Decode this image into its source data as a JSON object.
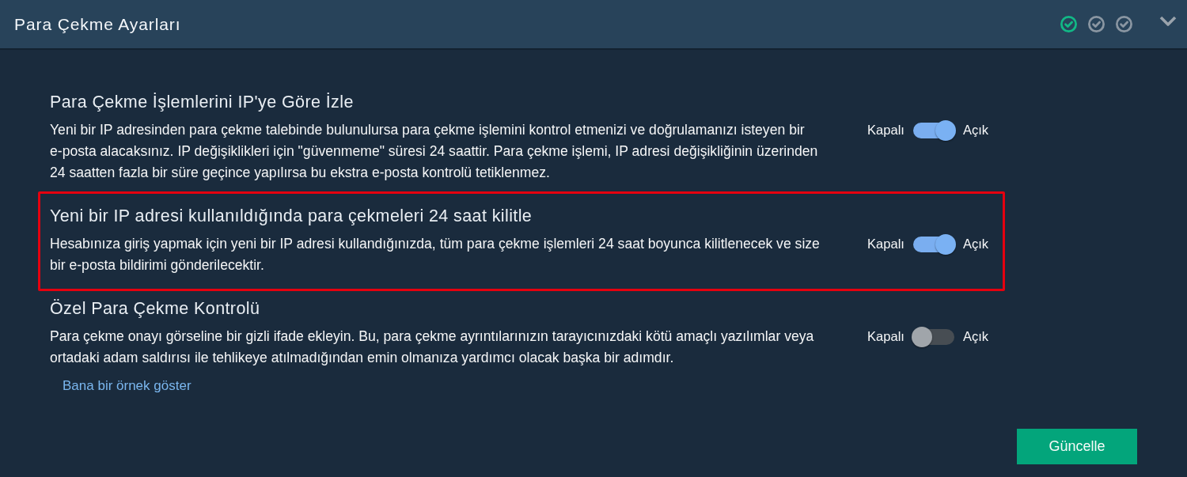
{
  "header": {
    "title": "Para Çekme Ayarları",
    "steps": [
      {
        "completed": true
      },
      {
        "completed": false
      },
      {
        "completed": false
      }
    ]
  },
  "sections": [
    {
      "title": "Para Çekme İşlemlerini IP'ye Göre İzle",
      "description": "Yeni bir IP adresinden para çekme talebinde bulunulursa para çekme işlemini kontrol etmenizi ve doğrulamanızı isteyen bir e-posta alacaksınız. IP değişiklikleri için \"güvenmeme\" süresi 24 saattir. Para çekme işlemi, IP adresi değişikliğinin üzerinden 24 saatten fazla bir süre geçince yapılırsa bu ekstra e-posta kontrolü tetiklenmez.",
      "highlighted": false,
      "toggle": {
        "off_label": "Kapalı",
        "on_label": "Açık",
        "on": true
      }
    },
    {
      "title": "Yeni bir IP adresi kullanıldığında para çekmeleri 24 saat kilitle",
      "description": "Hesabınıza giriş yapmak için yeni bir IP adresi kullandığınızda, tüm para çekme işlemleri 24 saat boyunca kilitlenecek ve size bir e-posta bildirimi gönderilecektir.",
      "highlighted": true,
      "toggle": {
        "off_label": "Kapalı",
        "on_label": "Açık",
        "on": true
      }
    },
    {
      "title": "Özel Para Çekme Kontrolü",
      "description": "Para çekme onayı görseline bir gizli ifade ekleyin. Bu, para çekme ayrıntılarınızın tarayıcınızdaki kötü amaçlı yazılımlar veya ortadaki adam saldırısı ile tehlikeye atılmadığından emin olmanıza yardımcı olacak başka bir adımdır.",
      "highlighted": false,
      "toggle": {
        "off_label": "Kapalı",
        "on_label": "Açık",
        "on": false
      },
      "link": "Bana bir örnek göster"
    }
  ],
  "update_button": "Güncelle"
}
